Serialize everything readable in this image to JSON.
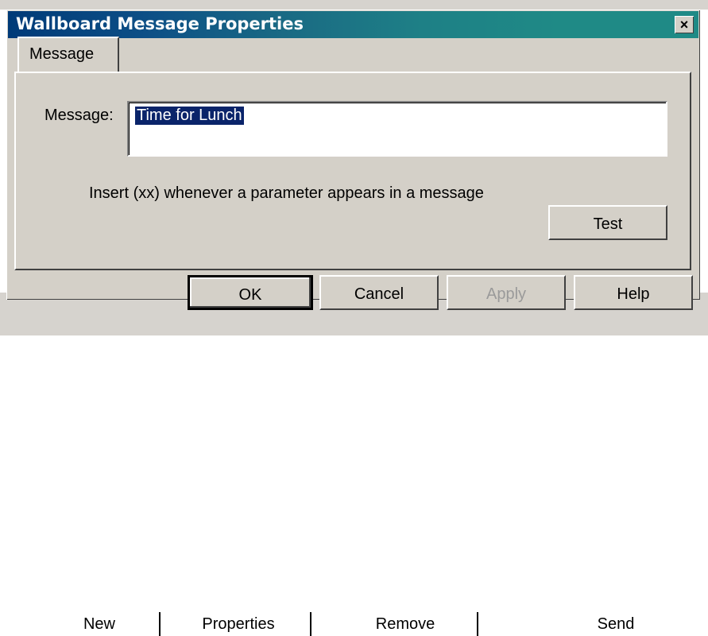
{
  "window": {
    "title": "Wallboard Message Properties",
    "close_label": "×"
  },
  "tabs": [
    {
      "label": "Message"
    }
  ],
  "form": {
    "message_label": "Message:",
    "message_value": "Time for Lunch",
    "hint": "Insert (xx) whenever a parameter appears in a message"
  },
  "buttons": {
    "test": "Test",
    "ok": "OK",
    "cancel": "Cancel",
    "apply": "Apply",
    "help": "Help"
  },
  "background_buttons": {
    "new": "New",
    "properties": "Properties",
    "remove": "Remove",
    "send": "Send"
  },
  "colors": {
    "dialog_face": "#d4d0c8",
    "title_start": "#003a78",
    "title_end": "#1f8a86",
    "selection": "#0a246a"
  }
}
